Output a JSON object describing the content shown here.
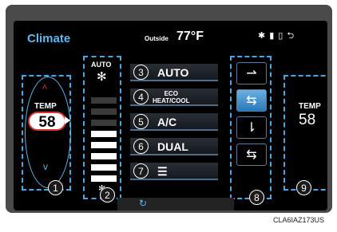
{
  "header": {
    "title": "Climate",
    "outside_label": "Outside",
    "outside_temp": "77°F"
  },
  "status": {
    "bluetooth": "✱",
    "signal": "▮",
    "battery": "▯",
    "back": "⮌"
  },
  "left_temp": {
    "label": "TEMP",
    "value": "58",
    "up": "^",
    "down": "v",
    "marker": "1"
  },
  "fan": {
    "auto_label": "AUTO",
    "icon": "✻",
    "small_icon": "✻",
    "marker": "2",
    "level": 5
  },
  "buttons": [
    {
      "marker": "3",
      "label": "AUTO"
    },
    {
      "marker": "4",
      "label_top": "ECO",
      "label_bottom": "HEAT/COOL"
    },
    {
      "marker": "5",
      "label": "A/C"
    },
    {
      "marker": "6",
      "label": "DUAL"
    },
    {
      "marker": "7",
      "label": "☰"
    }
  ],
  "vents": {
    "marker": "8",
    "items": [
      {
        "icon": "⇀"
      },
      {
        "icon": "⇆"
      },
      {
        "icon": "⇂"
      },
      {
        "icon": "⇆"
      }
    ]
  },
  "right_temp": {
    "label": "TEMP",
    "value": "58",
    "marker": "9"
  },
  "bottom": {
    "recirc_icon": "↻"
  },
  "caption": "CLA6IAZ173US"
}
